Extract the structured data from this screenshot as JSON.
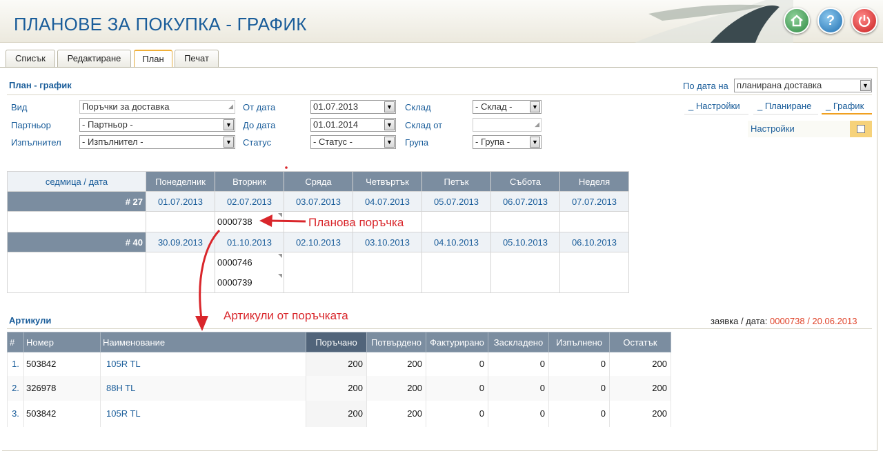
{
  "header": {
    "title": "ПЛАНОВЕ ЗА ПОКУПКА - ГРАФИК"
  },
  "tabs": [
    {
      "label": "Списък"
    },
    {
      "label": "Редактиране"
    },
    {
      "label": "План"
    },
    {
      "label": "Печат"
    }
  ],
  "active_tab": "План",
  "plan": {
    "title": "План - график",
    "by_date_label": "По дата на",
    "by_date_value": "планирана доставка",
    "filters": {
      "vid_label": "Вид",
      "vid_value": "Поръчки за доставка",
      "partner_label": "Партньор",
      "partner_value": "- Партньор -",
      "executor_label": "Изпълнител",
      "executor_value": "- Изпълнител -",
      "from_label": "От дата",
      "from_value": "01.07.2013",
      "to_label": "До дата",
      "to_value": "01.01.2014",
      "status_label": "Статус",
      "status_value": "- Статус -",
      "warehouse_label": "Склад",
      "warehouse_value": "- Склад -",
      "warehouse_from_label": "Склад от",
      "warehouse_from_value": "",
      "group_label": "Група",
      "group_value": "- Група -"
    },
    "mini_tabs": [
      "_ Настройки",
      "_ Планиране",
      "_ График"
    ],
    "settings_label": "Настройки"
  },
  "calendar": {
    "corner_label": "седмица / дата",
    "days": [
      "Понеделник",
      "Вторник",
      "Сряда",
      "Четвъртък",
      "Петък",
      "Събота",
      "Неделя"
    ],
    "weeks": [
      {
        "label": "# 27",
        "dates": [
          "01.07.2013",
          "02.07.2013",
          "03.07.2013",
          "04.07.2013",
          "05.07.2013",
          "06.07.2013",
          "07.07.2013"
        ],
        "orders": [
          [],
          [
            "0000738"
          ],
          [],
          [],
          [],
          [],
          []
        ]
      },
      {
        "label": "# 40",
        "dates": [
          "30.09.2013",
          "01.10.2013",
          "02.10.2013",
          "03.10.2013",
          "04.10.2013",
          "05.10.2013",
          "06.10.2013"
        ],
        "orders": [
          [],
          [
            "0000746",
            "0000739"
          ],
          [],
          [],
          [],
          [],
          []
        ]
      }
    ]
  },
  "annotations": {
    "planned_order": "Планова поръчка",
    "order_articles": "Артикули от поръчката"
  },
  "articles": {
    "title": "Артикули",
    "request_label": "заявка / дата:",
    "request_value": "0000738 / 20.06.2013",
    "columns": [
      "#",
      "Номер",
      "Наименование",
      "Поръчано",
      "Потвърдено",
      "Фактурирано",
      "Заскладено",
      "Изпълнено",
      "Остатък"
    ],
    "rows": [
      {
        "idx": "1.",
        "code": "503842",
        "name": "105R TL",
        "ordered": "200",
        "confirmed": "200",
        "invoiced": "0",
        "stored": "0",
        "done": "0",
        "rest": "200"
      },
      {
        "idx": "2.",
        "code": "326978",
        "name": "88H TL",
        "ordered": "200",
        "confirmed": "200",
        "invoiced": "0",
        "stored": "0",
        "done": "0",
        "rest": "200"
      },
      {
        "idx": "3.",
        "code": "503842",
        "name": "105R TL",
        "ordered": "200",
        "confirmed": "200",
        "invoiced": "0",
        "stored": "0",
        "done": "0",
        "rest": "200"
      }
    ]
  },
  "colors": {
    "accent": "#1a5d9a",
    "header_cell": "#7b8da0",
    "annotation": "#d9262b",
    "active_tab": "#f0b03a"
  },
  "icons": [
    "home-icon",
    "help-icon",
    "power-icon",
    "dropdown-arrow-icon",
    "checkbox-icon"
  ]
}
